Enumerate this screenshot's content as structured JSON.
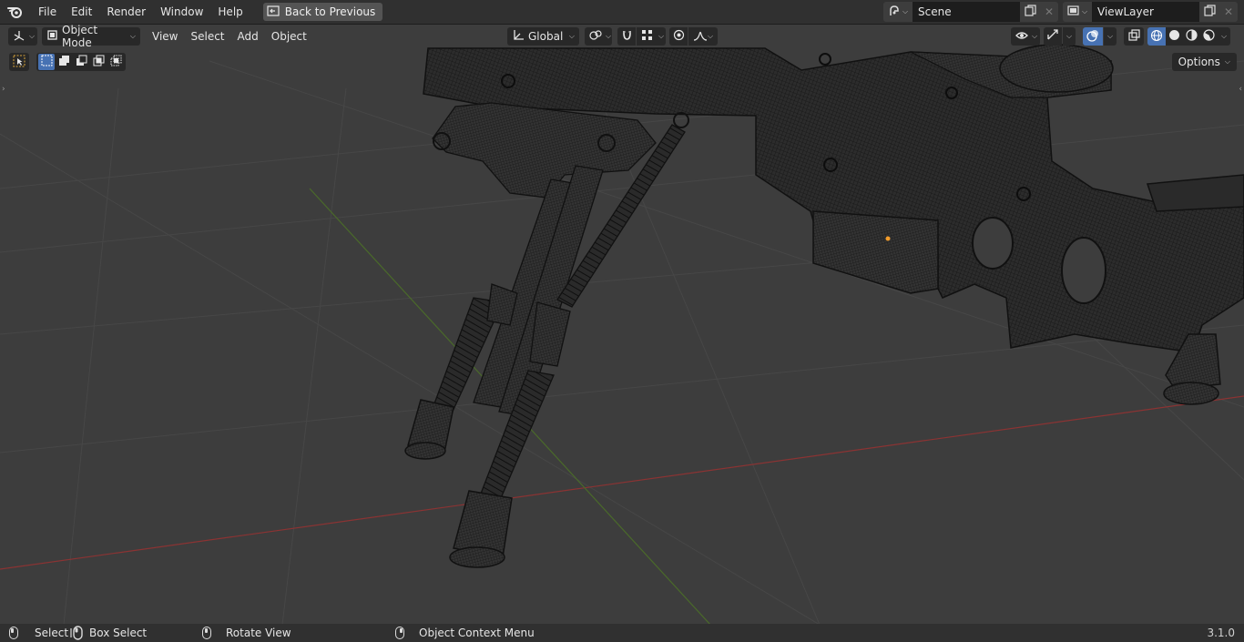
{
  "topbar": {
    "logo_icon": "blender-logo-icon",
    "menus": [
      "File",
      "Edit",
      "Render",
      "Window",
      "Help"
    ],
    "back_button": "Back to Previous",
    "scene": {
      "name": "Scene"
    },
    "view_layer": {
      "name": "ViewLayer"
    }
  },
  "viewport_header": {
    "editor_type_icon": "3d-viewport-icon",
    "mode": "Object Mode",
    "menus": [
      "View",
      "Select",
      "Add",
      "Object"
    ],
    "transform_orientation": "Global",
    "options_label": "Options"
  },
  "toolbar": {
    "active_tool_icon": "select-cursor-icon",
    "selection_modes": [
      "set-new-icon",
      "extend-icon",
      "subtract-icon",
      "invert-icon",
      "intersect-icon"
    ]
  },
  "statusbar": {
    "items": [
      {
        "label": "Select",
        "icon": "mouse-left-icon"
      },
      {
        "label": "Box Select",
        "icon": "mouse-drag-icon"
      },
      {
        "label": "Rotate View",
        "icon": "mouse-middle-icon"
      },
      {
        "label": "Object Context Menu",
        "icon": "mouse-right-icon"
      }
    ],
    "version": "3.1.0"
  },
  "colors": {
    "viewport_bg": "#3d3d3d",
    "header_bg": "#303030",
    "accent": "#4772b3",
    "x_axis": "#8b3333",
    "y_axis": "#4a6a2a",
    "wire": "#1a1a1a",
    "origin": "#f39c2a"
  }
}
